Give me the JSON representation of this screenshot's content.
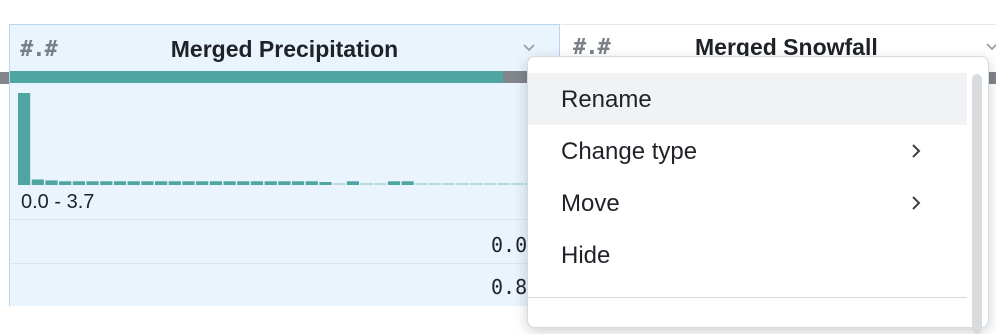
{
  "columns": [
    {
      "type_icon": "#.#",
      "title": "Merged Precipitation",
      "histogram": {
        "range_label": "0.0 - 3.7",
        "bins": [
          1.0,
          0.06,
          0.05,
          0.04,
          0.04,
          0.04,
          0.04,
          0.04,
          0.04,
          0.04,
          0.04,
          0.04,
          0.04,
          0.04,
          0.04,
          0.04,
          0.04,
          0.04,
          0.04,
          0.04,
          0.04,
          0.04,
          0.03,
          0.0,
          0.04,
          0.0,
          0.0,
          0.04,
          0.04,
          0.0,
          0.0,
          0.0,
          0.0,
          0.0,
          0.0,
          0.0,
          0.0,
          0.0
        ]
      },
      "cells": [
        "0.0",
        "0.8"
      ]
    },
    {
      "type_icon": "#.#",
      "title": "Merged Snowfall"
    }
  ],
  "context_menu": {
    "items": [
      {
        "label": "Rename",
        "has_submenu": false
      },
      {
        "label": "Change type",
        "has_submenu": true
      },
      {
        "label": "Move",
        "has_submenu": true
      },
      {
        "label": "Hide",
        "has_submenu": false
      }
    ]
  },
  "colors": {
    "selected_column_bg": "#eaf4fc",
    "histogram_teal": "#4ea5a2",
    "missing_gray": "#80868c"
  }
}
